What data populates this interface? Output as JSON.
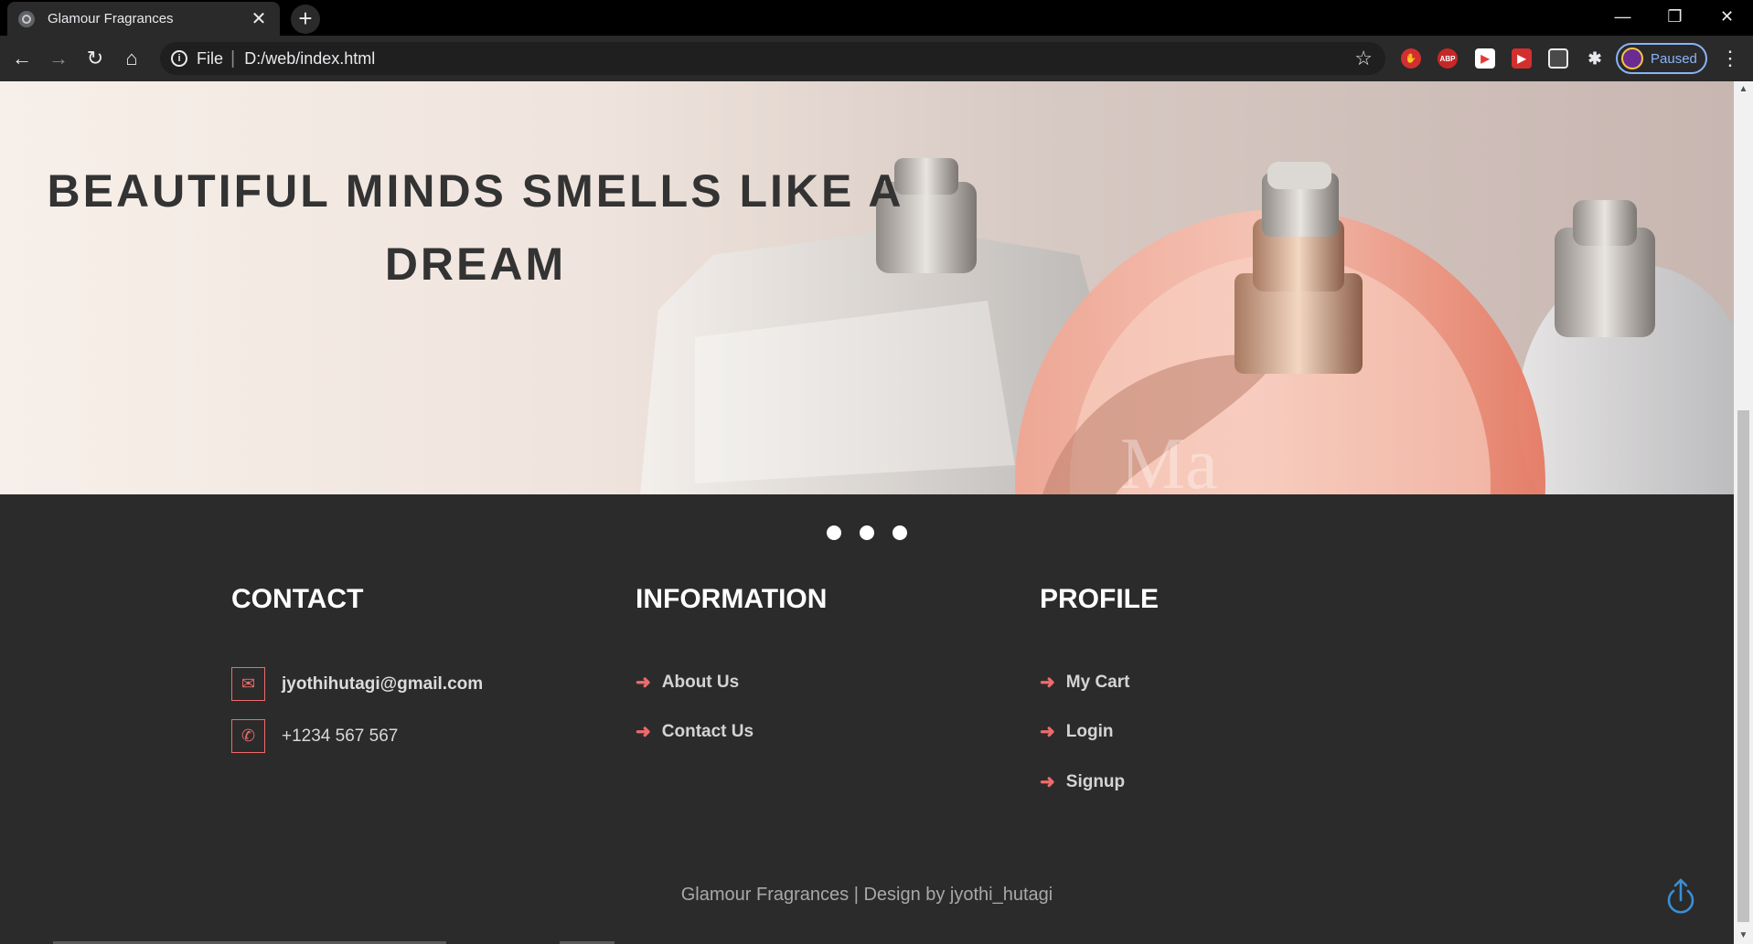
{
  "browser": {
    "tab_title": "Glamour Fragrances",
    "tab_close": "✕",
    "new_tab": "+",
    "address_scheme": "File",
    "address_separator": "|",
    "address_url": "D:/web/index.html",
    "profile_status": "Paused",
    "ext_labels": {
      "abp": "ABP"
    }
  },
  "hero": {
    "title_line1": "BEAUTIFUL MINDS SMELLS LIKE A",
    "title_line2": "DREAM"
  },
  "carousel": {
    "dot_count": 3
  },
  "footer": {
    "contact": {
      "heading": "CONTACT",
      "email": "jyothihutagi@gmail.com",
      "phone": "+1234 567 567"
    },
    "information": {
      "heading": "INFORMATION",
      "links": [
        "About Us",
        "Contact Us"
      ]
    },
    "profile": {
      "heading": "PROFILE",
      "links": [
        "My Cart",
        "Login",
        "Signup"
      ]
    },
    "copyright": "Glamour Fragrances | Design by jyothi_hutagi"
  },
  "colors": {
    "accent": "#ee6b6b",
    "footer_bg": "#2b2b2b",
    "to_top": "#3a8fd6"
  }
}
